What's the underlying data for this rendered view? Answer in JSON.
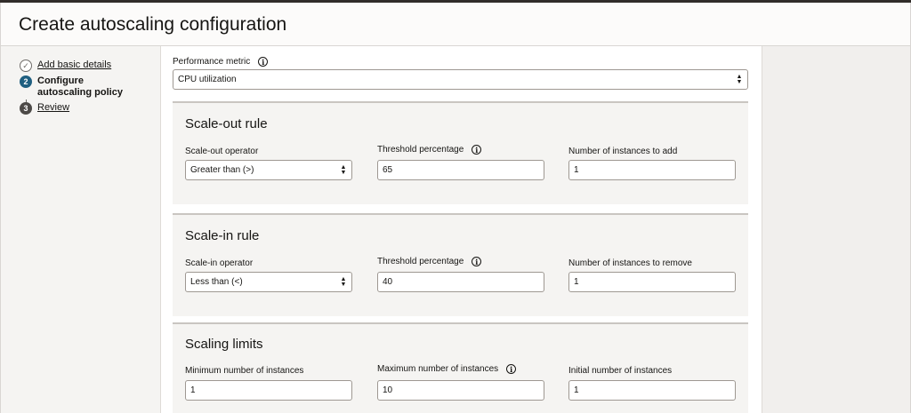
{
  "page_title": "Create autoscaling configuration",
  "steps": [
    {
      "number": "✓",
      "label": "Add basic details",
      "state": "done"
    },
    {
      "number": "2",
      "label": "Configure autoscaling policy",
      "state": "current"
    },
    {
      "number": "3",
      "label": "Review",
      "state": "todo"
    }
  ],
  "performance_metric": {
    "label": "Performance metric",
    "value": "CPU utilization"
  },
  "scale_out": {
    "title": "Scale-out rule",
    "operator_label": "Scale-out operator",
    "operator_value": "Greater than (>)",
    "threshold_label": "Threshold percentage",
    "threshold_value": "65",
    "instances_label": "Number of instances to add",
    "instances_value": "1"
  },
  "scale_in": {
    "title": "Scale-in rule",
    "operator_label": "Scale-in operator",
    "operator_value": "Less than (<)",
    "threshold_label": "Threshold percentage",
    "threshold_value": "40",
    "instances_label": "Number of instances to remove",
    "instances_value": "1"
  },
  "limits": {
    "title": "Scaling limits",
    "min_label": "Minimum number of instances",
    "min_value": "1",
    "max_label": "Maximum number of instances",
    "max_value": "10",
    "initial_label": "Initial number of instances",
    "initial_value": "1"
  },
  "icons": {
    "info": "info-icon",
    "check": "check-icon",
    "select_arrows": "chevron-updown-icon"
  },
  "colors": {
    "current_step": "#1f5f80",
    "panel_bg": "#f5f4f2",
    "sidebar_bg": "#f5f4f2"
  }
}
